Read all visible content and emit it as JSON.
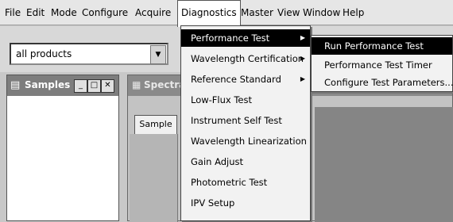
{
  "menubar": {
    "items": [
      "File",
      "Edit",
      "Mode",
      "Configure",
      "Acquire",
      "Diagnostics",
      "Master",
      "View",
      "Window",
      "Help"
    ],
    "active": "Diagnostics"
  },
  "toolbar": {
    "product_select": {
      "value": "all products"
    }
  },
  "samples_window": {
    "title": "Samples"
  },
  "spectra_window": {
    "title": "Spectra",
    "tab_label": "Sample"
  },
  "diagnostics_menu": {
    "items": [
      {
        "label": "Performance Test",
        "has_submenu": true,
        "highlighted": true
      },
      {
        "label": "Wavelength Certification",
        "has_submenu": true
      },
      {
        "label": "Reference Standard",
        "has_submenu": true
      },
      {
        "label": "Low-Flux Test"
      },
      {
        "label": "Instrument Self Test"
      },
      {
        "label": "Wavelength Linearization"
      },
      {
        "label": "Gain Adjust"
      },
      {
        "label": "Photometric Test"
      },
      {
        "label": "IPV Setup"
      }
    ]
  },
  "performance_submenu": {
    "items": [
      {
        "label": "Run Performance Test",
        "highlighted": true
      },
      {
        "label": "Performance Test Timer"
      },
      {
        "label": "Configure Test Parameters..."
      }
    ]
  }
}
